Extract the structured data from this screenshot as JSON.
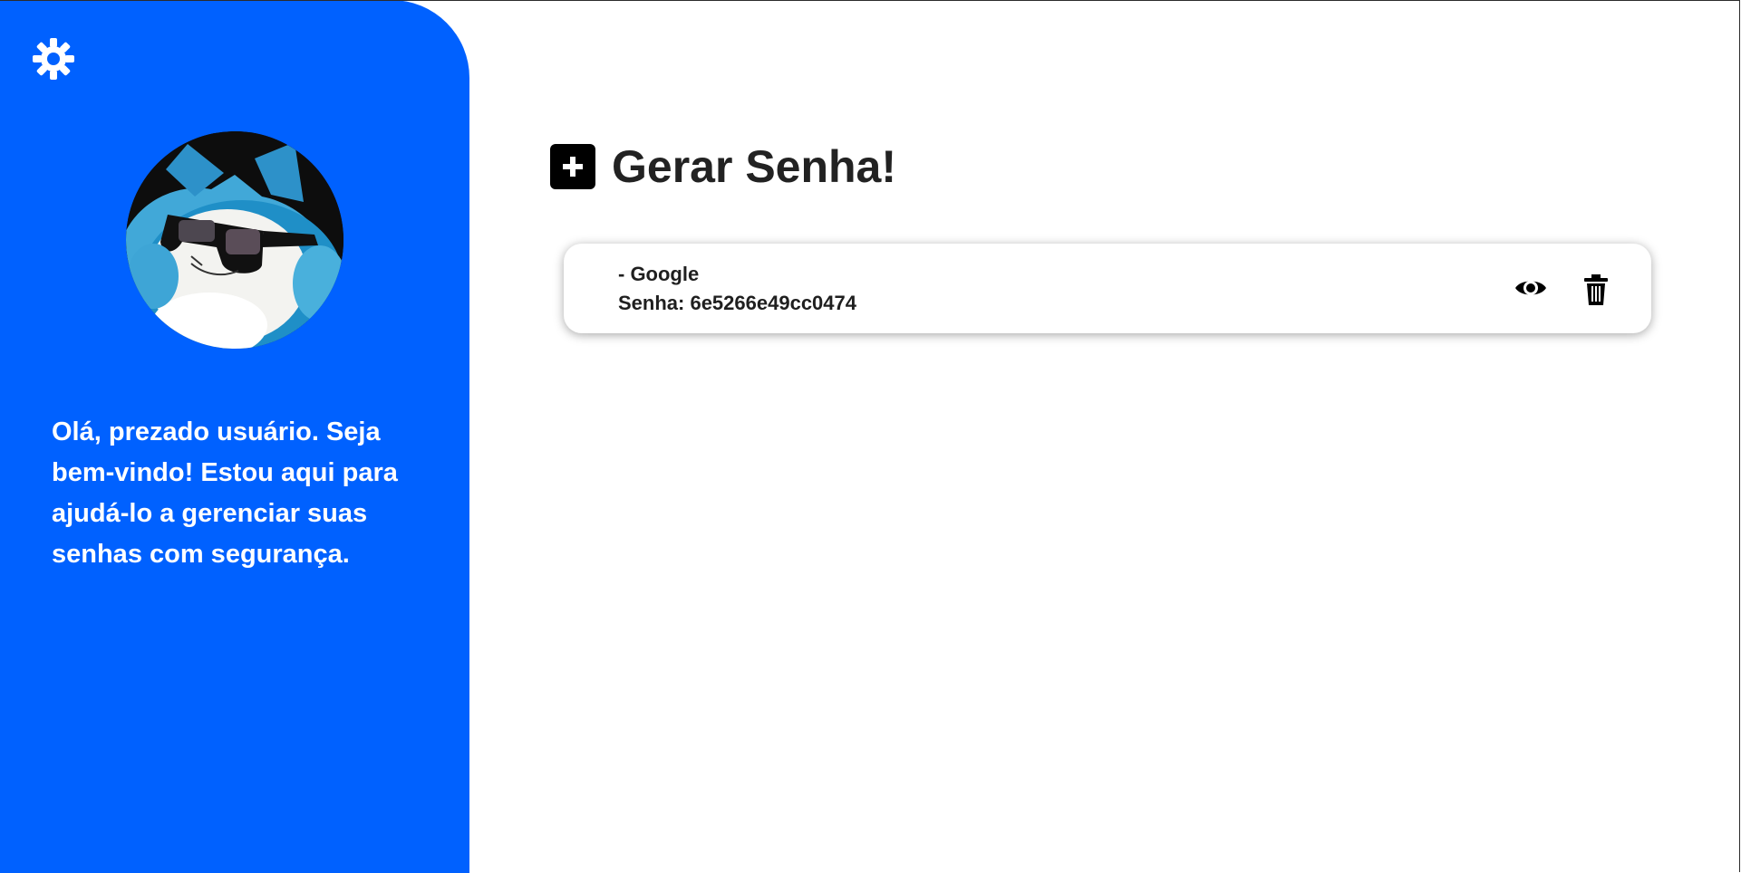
{
  "colors": {
    "sidebar_bg": "#0061ff",
    "text_dark": "#222222",
    "white": "#ffffff",
    "black": "#000000"
  },
  "sidebar": {
    "settings_icon": "gear-icon",
    "avatar_image": "snorlax-plush-with-sunglasses",
    "welcome_message": "Olá, prezado usuário. Seja bem-vindo! Estou aqui para ajudá-lo a gerenciar suas senhas com segurança."
  },
  "main": {
    "add_icon": "plus-square-icon",
    "title": "Gerar Senha!",
    "passwords": [
      {
        "service": "- Google",
        "password_label": "Senha: 6e5266e49cc0474",
        "view_icon": "eye-icon",
        "delete_icon": "trash-icon"
      }
    ]
  }
}
